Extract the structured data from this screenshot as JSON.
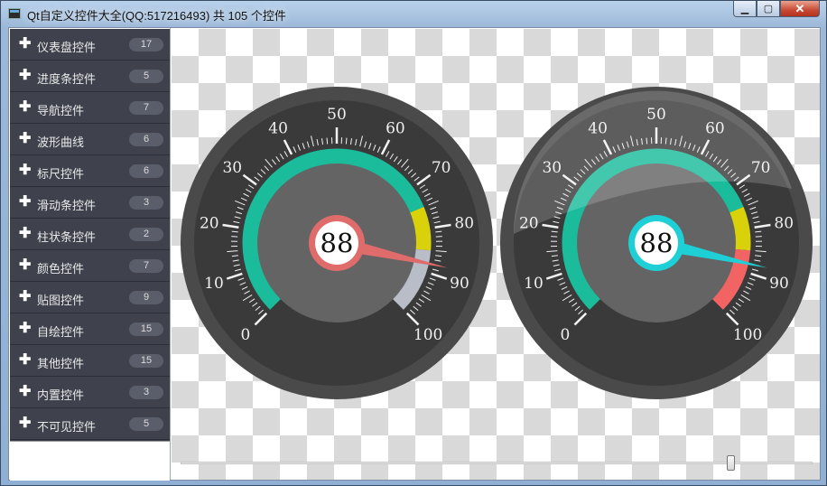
{
  "window": {
    "title": "Qt自定义控件大全(QQ:517216493) 共 105 个控件"
  },
  "sidebar": {
    "items": [
      {
        "label": "仪表盘控件",
        "count": "17"
      },
      {
        "label": "进度条控件",
        "count": "5"
      },
      {
        "label": "导航控件",
        "count": "7"
      },
      {
        "label": "波形曲线",
        "count": "6"
      },
      {
        "label": "标尺控件",
        "count": "6"
      },
      {
        "label": "滑动条控件",
        "count": "3"
      },
      {
        "label": "柱状条控件",
        "count": "2"
      },
      {
        "label": "颜色控件",
        "count": "7"
      },
      {
        "label": "贴图控件",
        "count": "9"
      },
      {
        "label": "自绘控件",
        "count": "15"
      },
      {
        "label": "其他控件",
        "count": "15"
      },
      {
        "label": "内置控件",
        "count": "3"
      },
      {
        "label": "不可见控件",
        "count": "5"
      }
    ]
  },
  "gauges": [
    {
      "value": 88,
      "value_text": "88",
      "min": 0,
      "max": 100,
      "scale_labels": [
        "0",
        "10",
        "20",
        "30",
        "40",
        "50",
        "60",
        "70",
        "80",
        "90",
        "100"
      ],
      "ranges": [
        {
          "from": 0,
          "to": 75,
          "color": "#1abc9c"
        },
        {
          "from": 75,
          "to": 85,
          "color": "#d9d20a"
        },
        {
          "from": 85,
          "to": 100,
          "color": "#b8bdc8"
        }
      ],
      "center_ring_color": "#e06b6b",
      "pointer_color": "#e06b6b",
      "glossy": false
    },
    {
      "value": 88,
      "value_text": "88",
      "min": 0,
      "max": 100,
      "scale_labels": [
        "0",
        "10",
        "20",
        "30",
        "40",
        "50",
        "60",
        "70",
        "80",
        "90",
        "100"
      ],
      "ranges": [
        {
          "from": 0,
          "to": 75,
          "color": "#1abc9c"
        },
        {
          "from": 75,
          "to": 85,
          "color": "#d9d20a"
        },
        {
          "from": 85,
          "to": 100,
          "color": "#f26464"
        }
      ],
      "center_ring_color": "#1ecfd6",
      "pointer_color": "#1ecfd6",
      "glossy": true
    }
  ],
  "slider": {
    "value_fraction": 0.87
  }
}
